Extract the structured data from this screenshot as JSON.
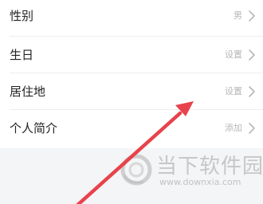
{
  "profile_rows": [
    {
      "label": "性别",
      "value": "男"
    },
    {
      "label": "生日",
      "value": "设置"
    },
    {
      "label": "居住地",
      "value": "设置"
    },
    {
      "label": "个人简介",
      "value": "添加"
    }
  ],
  "watermark": {
    "brand": "当下软件园",
    "url": "www.downxia.com"
  },
  "colors": {
    "arrow": "#e8424c",
    "list_background": "#ffffff",
    "page_background": "#f3f5f6"
  }
}
